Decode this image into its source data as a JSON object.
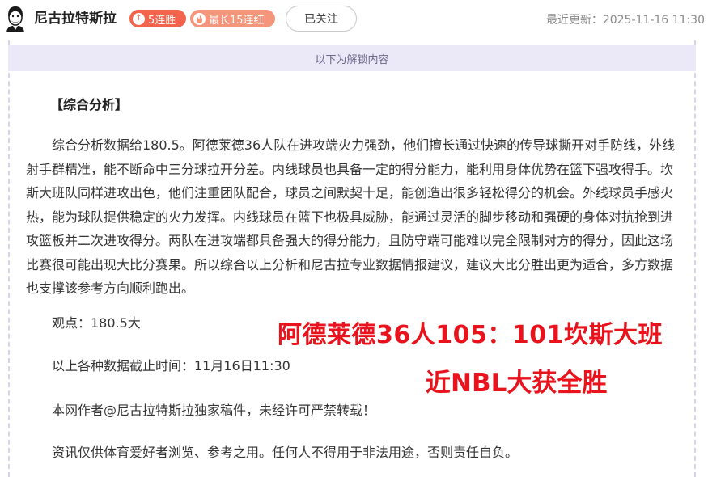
{
  "header": {
    "author_name": "尼古拉特斯拉",
    "badges": [
      {
        "label": "5连胜",
        "icon": "arrow-up-icon",
        "color": "#f2644b"
      },
      {
        "label": "最长15连红",
        "icon": "flame-icon",
        "color": "#f4967c"
      }
    ],
    "follow_label": "已关注",
    "last_updated": "最近更新：2025-11-16 11:30"
  },
  "unlock_banner": "以下为解锁内容",
  "article": {
    "section_title": "【综合分析】",
    "analysis": "综合分析数据给180.5。阿德莱德36人队在进攻端火力强劲，他们擅长通过快速的传导球撕开对手防线，外线射手群精准，能不断命中三分球拉开分差。内线球员也具备一定的得分能力，能利用身体优势在篮下强攻得手。坎斯大班队同样进攻出色，他们注重团队配合，球员之间默契十足，能创造出很多轻松得分的机会。外线球员手感火热，能为球队提供稳定的火力发挥。内线球员在篮下也极具威胁，能通过灵活的脚步移动和强硬的身体对抗抢到进攻篮板并二次进攻得分。两队在进攻端都具备强大的得分能力，且防守端可能难以完全限制对方的得分，因此这场比赛很可能出现大比分赛果。所以综合以上分析和尼古拉专业数据情报建议，建议大比分胜出更为适合，多方数据也支撑该参考方向顺利跑出。",
    "viewpoint": "观点：180.5大",
    "cutoff": "以上各种数据截止时间：11月16日11:30",
    "copyright": "本网作者@尼古拉特斯拉独家稿件，未经许可严禁转载！",
    "disclaimer": "资讯仅供体育爱好者浏览、参考之用。任何人不得用于非法用途，否则责任自负。"
  },
  "promo": {
    "line1": "阿德莱德36人105：101坎斯大班",
    "line2": "近NBL大获全胜",
    "color": "#e8131c"
  }
}
